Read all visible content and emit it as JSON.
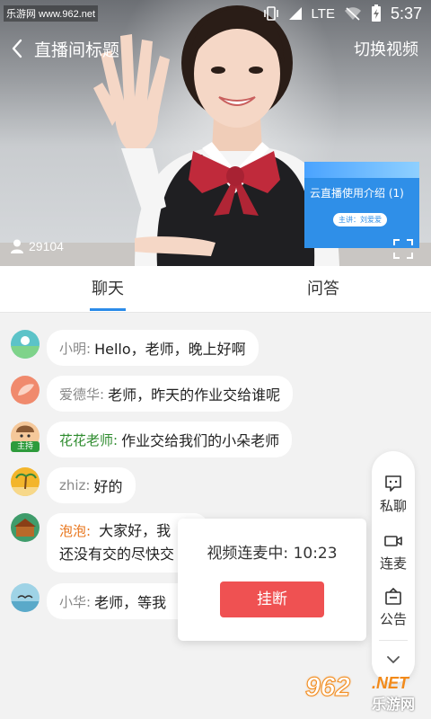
{
  "status_bar": {
    "watermark_text": "乐游网 www.962.net",
    "network": "LTE",
    "time": "5:37"
  },
  "header": {
    "title": "直播间标题",
    "switch_label": "切换视频"
  },
  "video": {
    "viewer_count": "29104",
    "slide": {
      "title": "云直播使用介绍 (1)",
      "presenter": "主讲：刘爱爱"
    }
  },
  "tabs": [
    {
      "label": "聊天",
      "active": true
    },
    {
      "label": "问答",
      "active": false
    }
  ],
  "messages": [
    {
      "nick": "小明:",
      "text": "Hello，老师，晚上好啊",
      "avatar_color": "#5cc3c8"
    },
    {
      "nick": "爱德华:",
      "text": "老师，昨天的作业交给谁呢",
      "avatar_color": "#f08a6d"
    },
    {
      "nick": "花花老师:",
      "text": "作业交给我们的小朵老师",
      "avatar_color": "#f5c89a",
      "host_tag": "主持"
    },
    {
      "nick": "zhiz:",
      "text": "好的",
      "avatar_color": "#f3b52b"
    },
    {
      "nick": "泡泡:",
      "text": "大家好，我",
      "text2": "还没有交的尽快交",
      "avatar_color": "#3f9c6b"
    },
    {
      "nick": "小华:",
      "text": "老师，等我",
      "avatar_color": "#9fd3e6"
    }
  ],
  "popup": {
    "status": "视频连麦中: 10:23",
    "hangup_label": "挂断"
  },
  "float_menu": {
    "items": [
      {
        "label": "私聊",
        "icon": "chat-bubble-icon"
      },
      {
        "label": "连麦",
        "icon": "video-camera-icon"
      },
      {
        "label": "公告",
        "icon": "announcement-icon"
      }
    ]
  },
  "watermark": {
    "number": "962",
    "suffix": ".NET",
    "cn": "乐游网"
  },
  "colors": {
    "accent_blue": "#2b8be9",
    "hangup_red": "#ef5152",
    "host_green": "#2e8b2e",
    "orange_nick": "#e8741a"
  }
}
